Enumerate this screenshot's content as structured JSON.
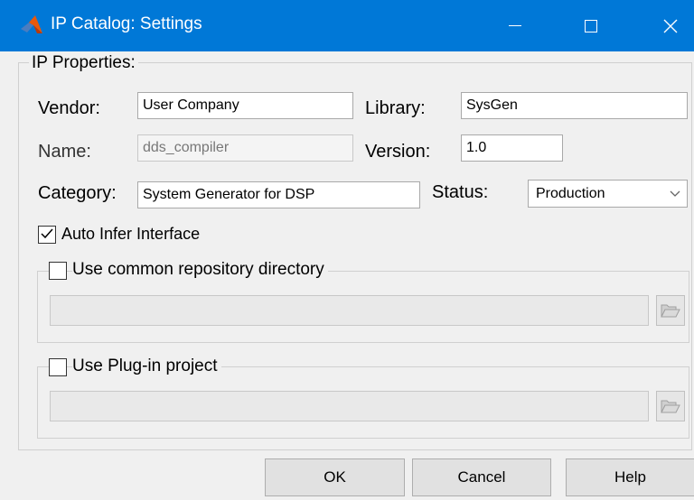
{
  "window": {
    "title": "IP Catalog: Settings",
    "icons": {
      "app": "matlab-logo-icon",
      "minimize": "minimize-icon",
      "maximize": "maximize-icon",
      "close": "close-icon"
    },
    "titlebar_color": "#0078d7"
  },
  "ip_properties": {
    "legend": "IP Properties:",
    "vendor": {
      "label": "Vendor:",
      "value": "User Company"
    },
    "library": {
      "label": "Library:",
      "value": "SysGen"
    },
    "name": {
      "label": "Name:",
      "value": "dds_compiler",
      "disabled": true
    },
    "version": {
      "label": "Version:",
      "value": "1.0"
    },
    "category": {
      "label": "Category:",
      "value": "System Generator for DSP"
    },
    "status": {
      "label": "Status:",
      "value": "Production"
    },
    "auto_infer": {
      "label": "Auto Infer Interface",
      "checked": true
    },
    "common_repo": {
      "label": "Use common repository directory",
      "checked": false,
      "path": "",
      "browse_icon": "folder-open-icon"
    },
    "plugin_project": {
      "label": "Use Plug-in project",
      "checked": false,
      "path": "",
      "browse_icon": "folder-open-icon"
    }
  },
  "buttons": {
    "ok": "OK",
    "cancel": "Cancel",
    "help": "Help"
  }
}
